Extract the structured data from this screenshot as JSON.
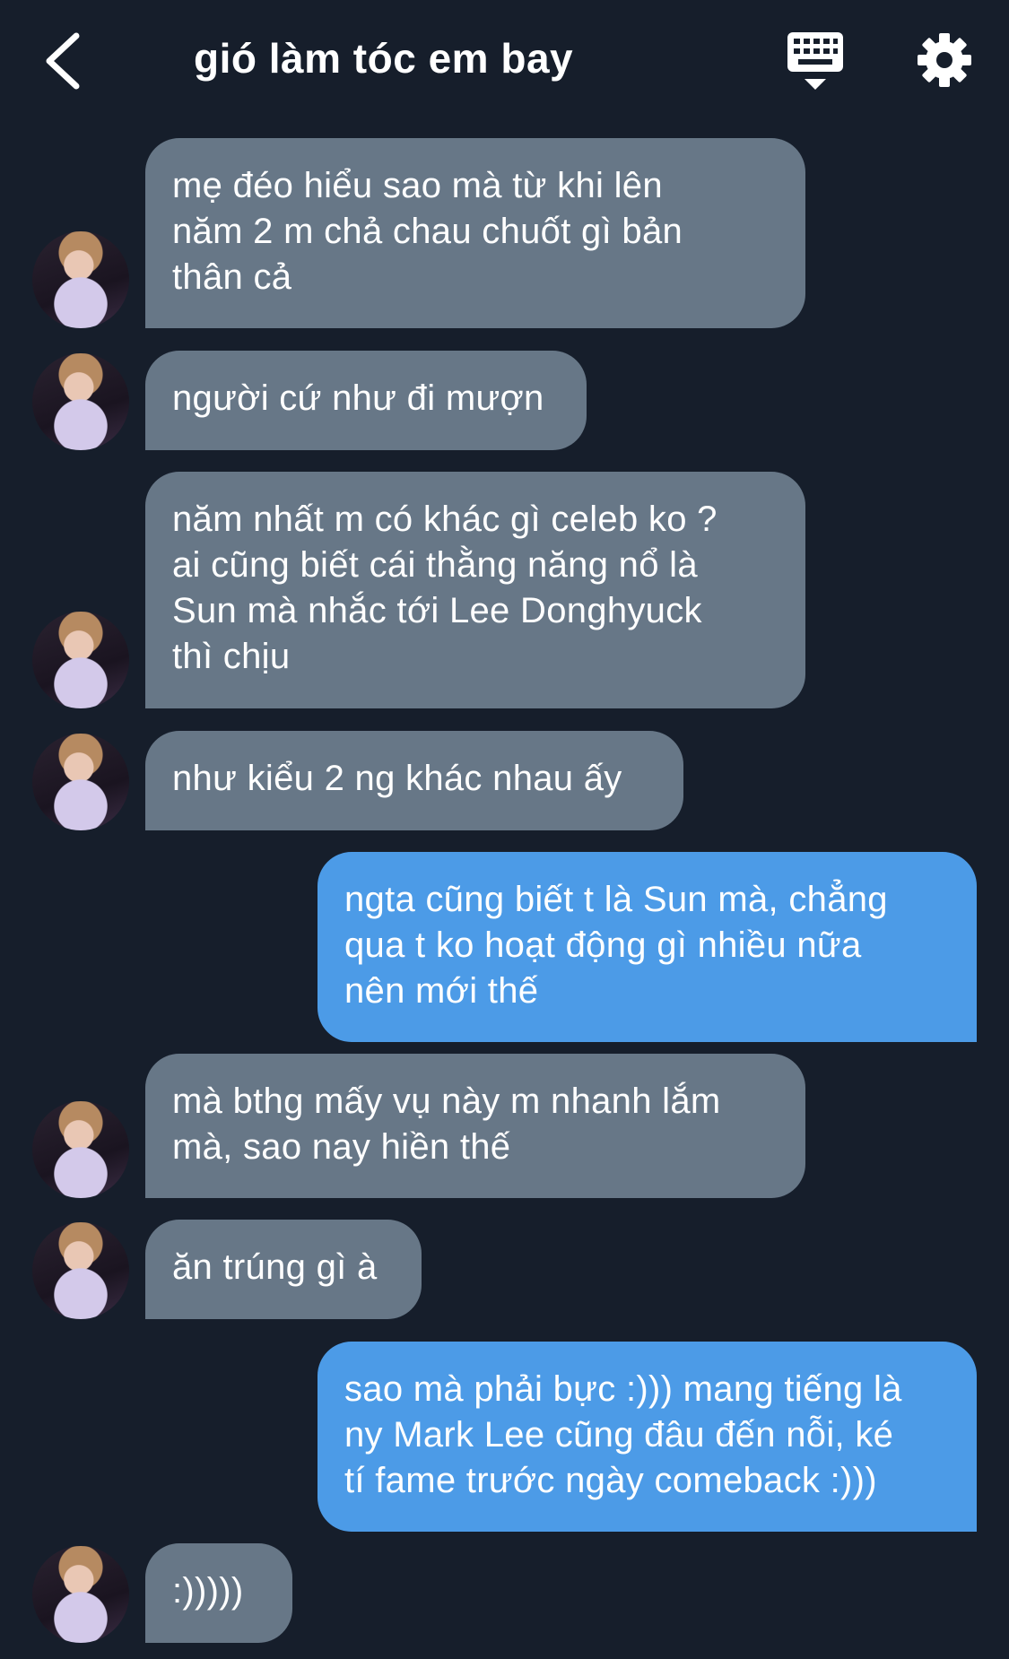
{
  "header": {
    "title": "gió làm tóc em bay"
  },
  "messages": [
    {
      "side": "in",
      "lines": [
        "mẹ đéo hiểu sao mà từ khi lên",
        "năm 2 m chả chau chuốt gì bản",
        "thân cả"
      ]
    },
    {
      "side": "in",
      "lines": [
        "người cứ như đi mượn"
      ]
    },
    {
      "side": "in",
      "lines": [
        "năm nhất m có khác gì celeb ko ?",
        "ai cũng biết cái thằng năng nổ là",
        "Sun mà nhắc tới Lee Donghyuck",
        "thì chịu"
      ]
    },
    {
      "side": "in",
      "lines": [
        "như kiểu 2 ng khác nhau ấy"
      ]
    },
    {
      "side": "out",
      "lines": [
        "ngta cũng biết t là Sun mà, chẳng",
        "qua t ko hoạt động gì nhiều nữa",
        "nên mới thế"
      ]
    },
    {
      "side": "in",
      "lines": [
        "mà bthg mấy vụ này m nhanh lắm",
        "mà, sao nay hiền thế"
      ]
    },
    {
      "side": "in",
      "lines": [
        "ăn trúng gì à"
      ]
    },
    {
      "side": "out",
      "lines": [
        "sao mà phải bực :))) mang tiếng là",
        "ny Mark Lee cũng đâu đến nỗi, ké",
        "tí fame trước ngày comeback :)))"
      ]
    },
    {
      "side": "in",
      "lines": [
        ":)))))"
      ]
    }
  ],
  "colors": {
    "background": "#161e2b",
    "incoming_bubble": "#677787",
    "outgoing_bubble": "#4c9be7"
  }
}
